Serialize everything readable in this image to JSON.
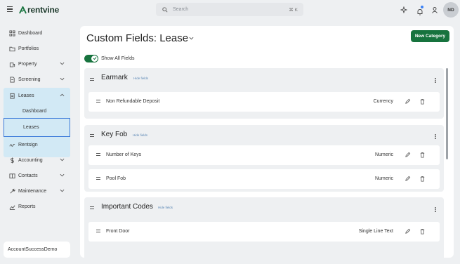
{
  "topbar": {
    "logo_text": "rentvine",
    "search_placeholder": "Search",
    "search_shortcut": "⌘ K",
    "avatar_initials": "ND",
    "icons": [
      "menu-icon",
      "sparkle-icon",
      "bell-icon",
      "user-icon"
    ],
    "brand_color": "#17733e"
  },
  "sidebar": {
    "items": [
      {
        "label": "Dashboard",
        "icon": "grid-icon"
      },
      {
        "label": "Portfolios",
        "icon": "folder-icon"
      },
      {
        "label": "Property",
        "icon": "building-icon",
        "expandable": true
      },
      {
        "label": "Screening",
        "icon": "document-icon",
        "expandable": true
      },
      {
        "label": "Leases",
        "icon": "clipboard-icon",
        "expanded": true
      },
      {
        "label": "Rentsign",
        "icon": "signature-icon"
      },
      {
        "label": "Accounting",
        "icon": "dollar-icon",
        "expandable": true
      },
      {
        "label": "Contacts",
        "icon": "contacts-icon",
        "expandable": true
      },
      {
        "label": "Maintenance",
        "icon": "wrench-icon",
        "expandable": true
      },
      {
        "label": "Reports",
        "icon": "chart-icon"
      }
    ],
    "leases_sub": [
      {
        "label": "Dashboard"
      },
      {
        "label": "Leases",
        "active": true
      }
    ],
    "account_name": "AccountSuccessDemo"
  },
  "main": {
    "title": "Custom Fields: Lease",
    "new_category_label": "New Category",
    "show_all_label": "Show All Fields",
    "show_all_on": true,
    "hide_fields_label": "Hide fields",
    "sections": [
      {
        "title": "Earmark",
        "fields": [
          {
            "name": "Non Refundable Deposit",
            "type": "Currency"
          }
        ]
      },
      {
        "title": "Key Fob",
        "fields": [
          {
            "name": "Number of Keys",
            "type": "Numeric"
          },
          {
            "name": "Pool Fob",
            "type": "Numeric"
          }
        ]
      },
      {
        "title": "Important Codes",
        "fields": [
          {
            "name": "Front Door",
            "type": "Single Line Text"
          }
        ]
      }
    ]
  }
}
